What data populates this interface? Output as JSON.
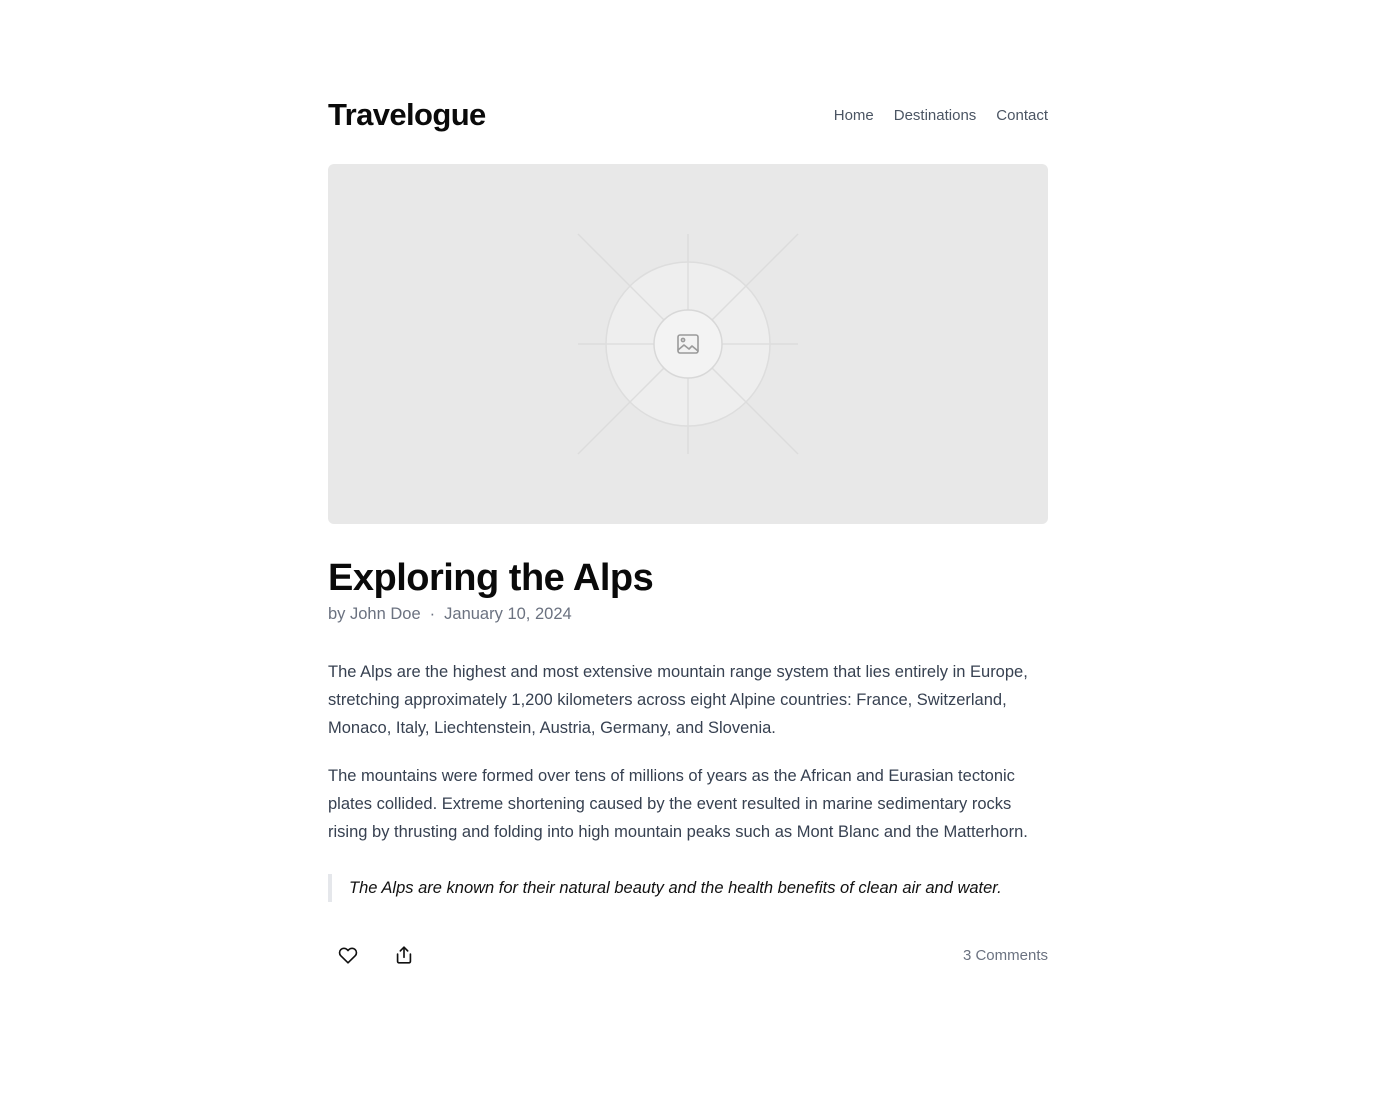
{
  "site": {
    "brand": "Travelogue"
  },
  "nav": {
    "items": [
      "Home",
      "Destinations",
      "Contact"
    ]
  },
  "hero": {
    "icon": "image-placeholder-icon"
  },
  "post": {
    "title": "Exploring the Alps",
    "author": "by John Doe",
    "separator": "·",
    "date": "January 10, 2024",
    "paragraphs": [
      "The Alps are the highest and most extensive mountain range system that lies entirely in Europe, stretching approximately 1,200 kilometers across eight Alpine countries: France, Switzerland, Monaco, Italy, Liechtenstein, Austria, Germany, and Slovenia.",
      "The mountains were formed over tens of millions of years as the African and Eurasian tectonic plates collided. Extreme shortening caused by the event resulted in marine sedimentary rocks rising by thrusting and folding into high mountain peaks such as Mont Blanc and the Matterhorn."
    ],
    "quote": "The Alps are known for their natural beauty and the health benefits of clean air and water."
  },
  "actions": {
    "like_icon": "heart-icon",
    "share_icon": "share-icon",
    "comments": "3 Comments"
  },
  "colors": {
    "text": "#111111",
    "muted": "#6b7280",
    "body": "#374151",
    "placeholder_bg": "#e8e8e8"
  }
}
